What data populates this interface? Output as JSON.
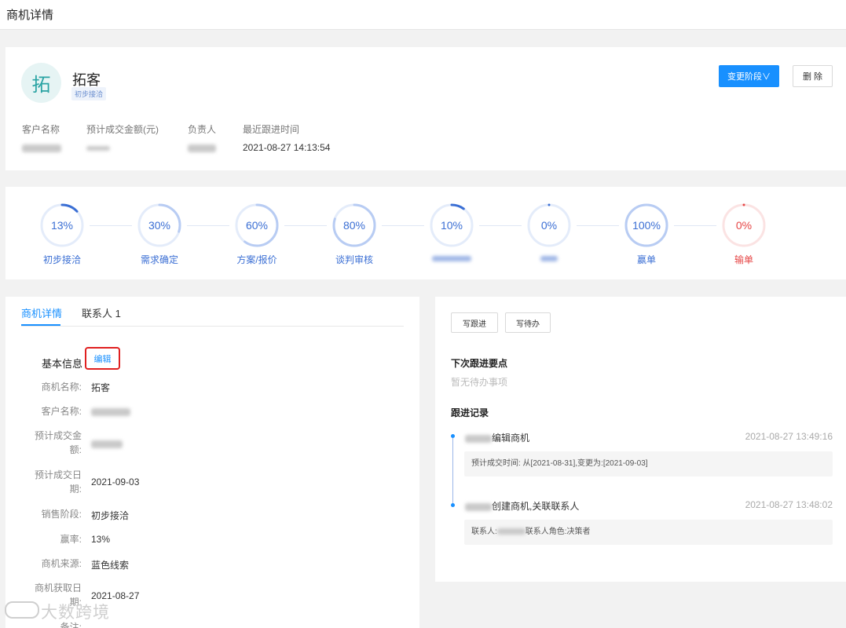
{
  "page_title": "商机详情",
  "header": {
    "avatar_char": "拓",
    "name": "拓客",
    "stage_tag": "初步接洽",
    "change_stage_button": "变更阶段∨",
    "delete_button": "删 除",
    "fields": [
      {
        "label": "客户名称",
        "value": ""
      },
      {
        "label": "预计成交金额(元)",
        "value": ""
      },
      {
        "label": "负责人",
        "value": ""
      },
      {
        "label": "最近跟进时间",
        "value": "2021-08-27 14:13:54"
      }
    ]
  },
  "stages": [
    {
      "percent_text": "13%",
      "label": "初步接洽",
      "progress": 0.13,
      "color": "#3b6fd4"
    },
    {
      "percent_text": "30%",
      "label": "需求确定",
      "progress": 0.3,
      "color": "#3b6fd4"
    },
    {
      "percent_text": "60%",
      "label": "方案/报价",
      "progress": 0.6,
      "color": "#3b6fd4"
    },
    {
      "percent_text": "80%",
      "label": "谈判审核",
      "progress": 0.8,
      "color": "#3b6fd4"
    },
    {
      "percent_text": "10%",
      "label": "",
      "progress": 0.1,
      "color": "#3b6fd4"
    },
    {
      "percent_text": "0%",
      "label": "",
      "progress": 0.0,
      "color": "#3b6fd4"
    },
    {
      "percent_text": "100%",
      "label": "赢单",
      "progress": 1.0,
      "color": "#3b6fd4"
    },
    {
      "percent_text": "0%",
      "label": "输单",
      "progress": 0.0,
      "color": "#e64545"
    }
  ],
  "detail": {
    "tabs": [
      "商机详情",
      "联系人 1"
    ],
    "section_title": "基本信息",
    "edit_link": "编辑",
    "fields": [
      {
        "label": "商机名称:",
        "value": "拓客"
      },
      {
        "label": "客户名称:",
        "value": ""
      },
      {
        "label": "预计成交金额:",
        "value": ""
      },
      {
        "label": "预计成交日期:",
        "value": "2021-09-03"
      },
      {
        "label": "销售阶段:",
        "value": "初步接洽"
      },
      {
        "label": "赢率:",
        "value": "13%"
      },
      {
        "label": "商机来源:",
        "value": "蓝色线索"
      },
      {
        "label": "商机获取日期:",
        "value": "2021-08-27"
      },
      {
        "label": "备注:",
        "value": ""
      }
    ]
  },
  "followup": {
    "write_followup_button": "写跟进",
    "write_todo_button": "写待办",
    "next_points_title": "下次跟进要点",
    "next_points_empty": "暂无待办事项",
    "records_title": "跟进记录",
    "records": [
      {
        "action": "编辑商机",
        "time": "2021-08-27 13:49:16",
        "detail": "预计成交时间: 从[2021-08-31],变更为:[2021-09-03]"
      },
      {
        "action": "创建商机,关联联系人",
        "time": "2021-08-27 13:48:02",
        "detail": "联系人:联系人角色:决策者"
      }
    ]
  },
  "watermark": "大数跨境"
}
